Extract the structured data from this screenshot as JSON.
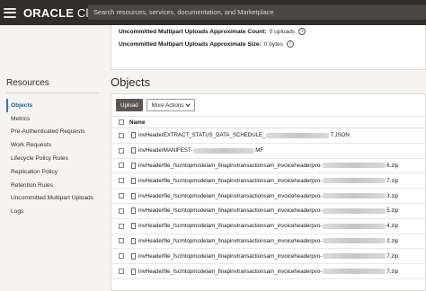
{
  "header": {
    "logo_main": "ORACLE",
    "logo_sub": " Cloud",
    "search_placeholder": "Search resources, services, documentation, and Marketplace"
  },
  "info": {
    "count_label": "Uncommitted Multipart Uploads Approximate Count:",
    "count_value": "0 uploads",
    "size_label": "Uncommitted Multipart Uploads Approximate Size:",
    "size_value": "0 bytes"
  },
  "sidebar": {
    "title": "Resources",
    "items": [
      {
        "label": "Objects",
        "active": true
      },
      {
        "label": "Metrics"
      },
      {
        "label": "Pre-Authenticated Requests"
      },
      {
        "label": "Work Requests"
      },
      {
        "label": "Lifecycle Policy Rules"
      },
      {
        "label": "Replication Policy"
      },
      {
        "label": "Retention Rules"
      },
      {
        "label": "Uncommitted Multipart Uploads"
      },
      {
        "label": "Logs"
      }
    ]
  },
  "objects": {
    "title": "Objects",
    "upload_label": "Upload",
    "more_actions_label": "More Actions",
    "name_header": "Name",
    "rows": [
      {
        "name": "invHeaderEXTRACT_STATUS_DATA_SCHEDULE_",
        "suffix": "7.JSON"
      },
      {
        "name": "invHeaderMANIFEST-",
        "suffix": "MF"
      },
      {
        "name": "invHeaderfile_fscmtopmodelam_finapinvtransactionsam_invoiceheaderpvo-",
        "suffix": "6.zip"
      },
      {
        "name": "invHeaderfile_fscmtopmodelam_finapinvtransactionsam_invoiceheaderpvo-",
        "suffix": "7.zip"
      },
      {
        "name": "invHeaderfile_fscmtopmodelam_finapinvtransactionsam_invoiceheaderpvo-",
        "suffix": "3.zip"
      },
      {
        "name": "invHeaderfile_fscmtopmodelam_finapinvtransactionsam_invoiceheaderpvo-",
        "suffix": "5.zip"
      },
      {
        "name": "invHeaderfile_fscmtopmodelam_finapinvtransactionsam_invoiceheaderpvo-",
        "suffix": "4.zip"
      },
      {
        "name": "invHeaderfile_fscmtopmodelam_finapinvtransactionsam_invoiceheaderpvo-",
        "suffix": "2.zip"
      },
      {
        "name": "invHeaderfile_fscmtopmodelam_finapinvtransactionsam_invoiceheaderpvo-",
        "suffix": "7.zip"
      },
      {
        "name": "invHeaderfile_fscmtopmodelam_finapinvtransactionsam_invoiceheaderpvo-",
        "suffix": "7.zip"
      }
    ]
  }
}
